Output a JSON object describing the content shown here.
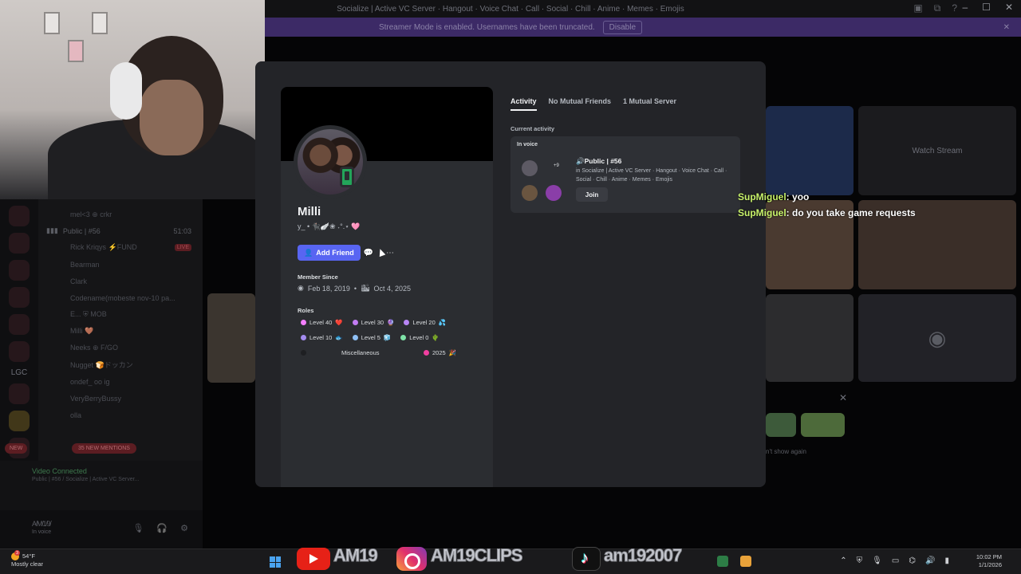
{
  "window": {
    "title": "Socialize | Active VC Server · Hangout · Voice Chat · Call · Social · Chill · Anime · Memes · Emojis",
    "minimize": "–",
    "maximize": "☐",
    "close": "✕"
  },
  "streamer_bar": {
    "text": "Streamer Mode is enabled. Usernames have been truncated.",
    "button": "Disable",
    "close": "✕"
  },
  "background": {
    "lgc_label": "LGC",
    "voice_channel": "Public | #56",
    "voice_channel_time": "51:03",
    "live_badge": "LIVE",
    "members": [
      "mel<3  ⊕ crkr",
      "Rick Kriqys ⚡FUND",
      "Bearman",
      "Clark",
      "Codename(mobeste nov-10 pa...",
      "E...  ⛨ MOB",
      "Milli 🤎",
      "Neeks ⊕ F/GO",
      "Nugget 🍞ドッカン",
      "ondef_ oo ig",
      "VeryBerryBussy",
      "olla"
    ],
    "new_pill": "NEW",
    "mentions_pill": "35 NEW MENTIONS",
    "voice_connected": "Video Connected",
    "voice_connected_sub": "Public | #56 / Socialize | Active VC Server...",
    "user_name": "A̸M̸1̸9̸",
    "user_status": "In voice",
    "watch_stream": "Watch Stream",
    "dont_show": "n't show again",
    "hide_close": "✕"
  },
  "chat_overlay": [
    {
      "user": "SupMiguel",
      "message": "yoo"
    },
    {
      "user": "SupMiguel",
      "message": "do you take game requests"
    }
  ],
  "profile": {
    "display_name": "Milli",
    "username_line": "y_  •  🐈‍⬛🪽❀ ˖°.⋆  🩷",
    "add_friend": "Add Friend",
    "member_since_label": "Member Since",
    "discord_date": "Feb 18, 2019",
    "server_date": "Oct 4, 2025",
    "roles_label": "Roles",
    "roles": [
      {
        "name": "Level 40",
        "emoji": "❤️",
        "color": "#f47fff"
      },
      {
        "name": "Level 30",
        "emoji": "🔮",
        "color": "#c27cf2"
      },
      {
        "name": "Level 20",
        "emoji": "💦",
        "color": "#b785f5"
      },
      {
        "name": "Level 10",
        "emoji": "🐟",
        "color": "#a48cf0"
      },
      {
        "name": "Level 5",
        "emoji": "🧊",
        "color": "#8fc0f5"
      },
      {
        "name": "Level 0",
        "emoji": "🌵",
        "color": "#7fe3a8"
      },
      {
        "name": "Miscellaneous",
        "emoji": "",
        "color": "#2b2d31"
      },
      {
        "name": "2025",
        "emoji": "🎉",
        "color": "#f03fa0"
      }
    ]
  },
  "tabs": [
    "Activity",
    "No Mutual Friends",
    "1 Mutual Server"
  ],
  "activity": {
    "section_label": "Current activity",
    "card_label": "In voice",
    "plus_count": "+9",
    "channel_name": "🔊Public | #56",
    "channel_sub": "in Socialize | Active VC Server · Hangout · Voice Chat · Call · Social · Chill · Anime · Memes · Emojis",
    "join_button": "Join"
  },
  "taskbar": {
    "weather_temp": "54°F",
    "weather_desc": "Mostly clear",
    "weather_badge": "3",
    "overlay_1": "AM19",
    "overlay_2": "AM19CLIPS",
    "overlay_3": "am192007",
    "time": "10:02 PM",
    "date": "1/1/2026"
  },
  "colors": {
    "blurple": "#5865f2",
    "online_green": "#23a55a",
    "chat_user": "#c8f26b",
    "streamer_purple": "#3c2a66"
  }
}
